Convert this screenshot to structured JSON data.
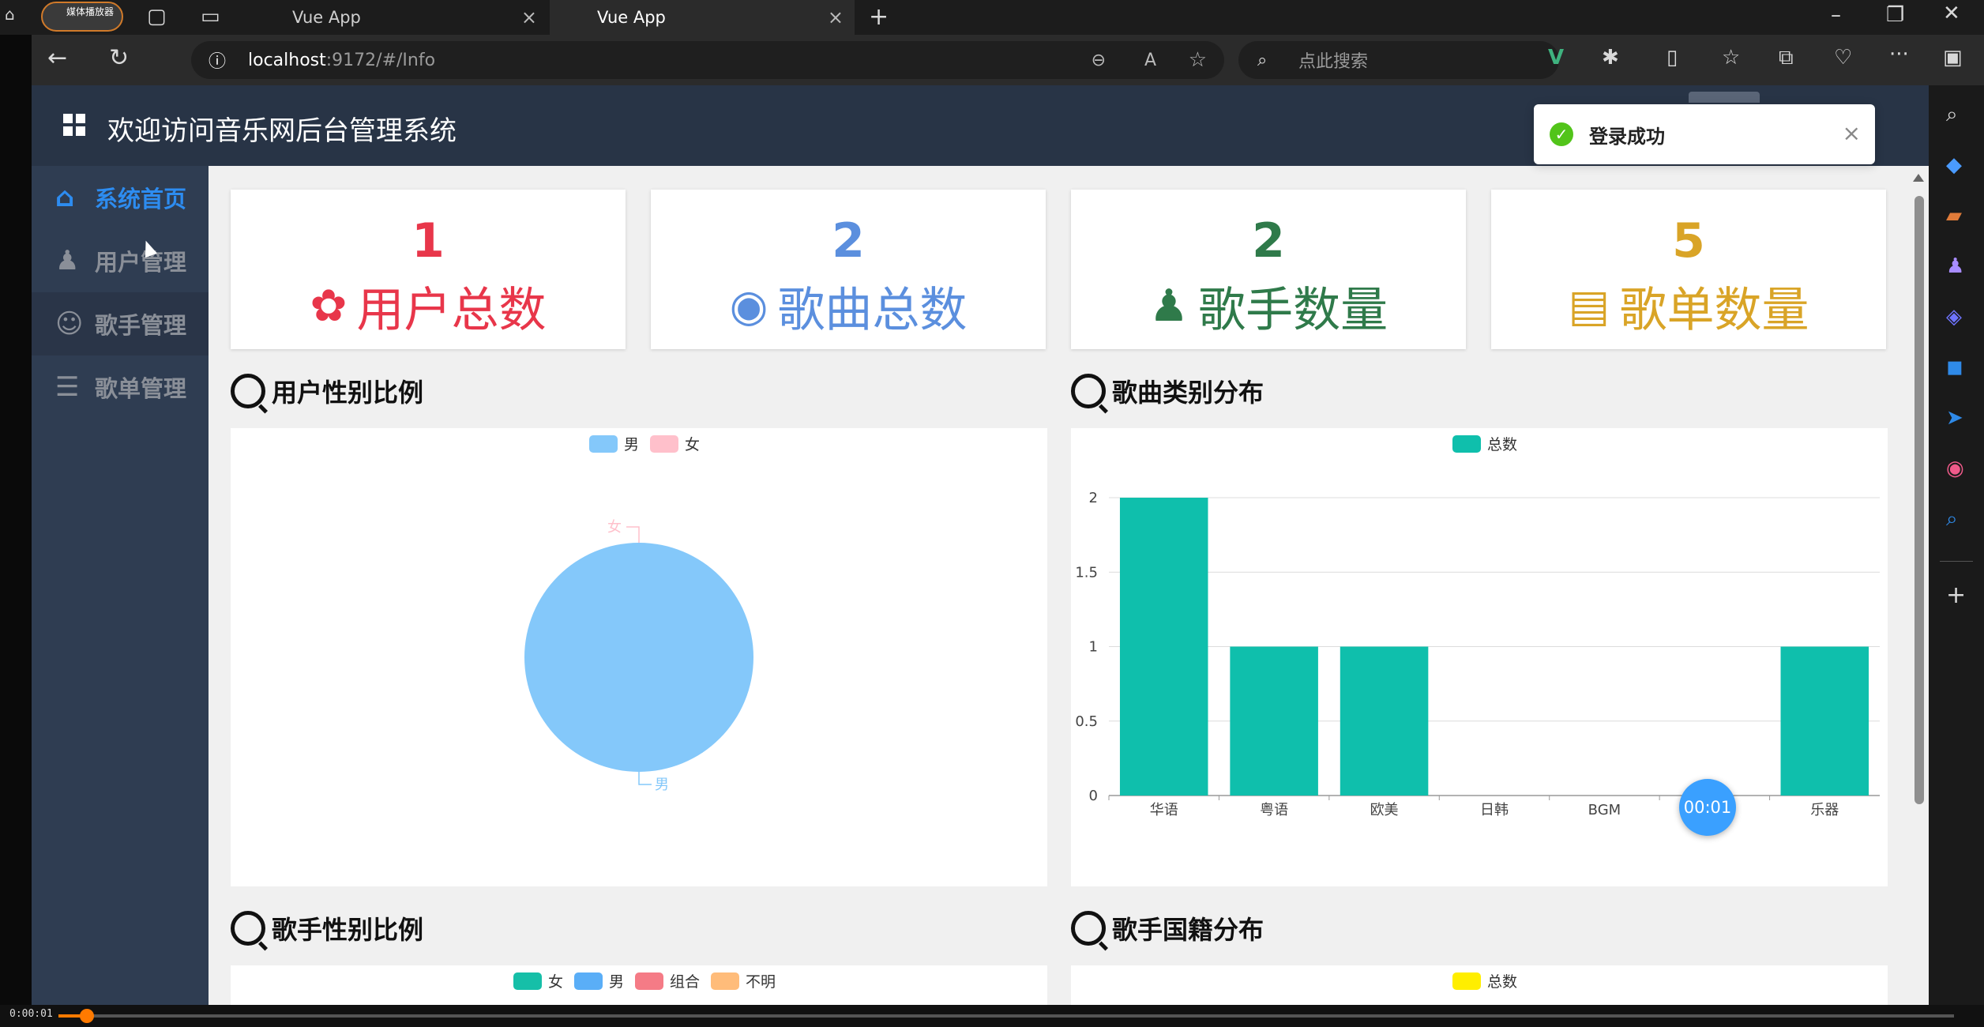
{
  "browser": {
    "media_badge": "媒体播放器",
    "tabs": [
      {
        "label": "Vue App",
        "active": false
      },
      {
        "label": "Vue App",
        "active": true
      }
    ],
    "url_host": "localhost",
    "url_rest": ":9172/#/Info",
    "search_placeholder": "点此搜索"
  },
  "app": {
    "title": "欢迎访问音乐网后台管理系统",
    "sidebar": {
      "items": [
        {
          "label": "系统首页",
          "icon": "home-icon"
        },
        {
          "label": "用户管理",
          "icon": "user-icon"
        },
        {
          "label": "歌手管理",
          "icon": "singer-icon"
        },
        {
          "label": "歌单管理",
          "icon": "list-icon"
        }
      ]
    },
    "cards": [
      {
        "value": "1",
        "label": "用户总数",
        "color": "#e8364a",
        "icon": "users-icon"
      },
      {
        "value": "2",
        "label": "歌曲总数",
        "color": "#5b8fde",
        "icon": "song-icon"
      },
      {
        "value": "2",
        "label": "歌手数量",
        "color": "#2f7a4a",
        "icon": "singer-icon"
      },
      {
        "value": "5",
        "label": "歌单数量",
        "color": "#d9a427",
        "icon": "playlist-icon"
      }
    ],
    "sections": {
      "user_gender": "用户性别比例",
      "song_category": "歌曲类别分布",
      "singer_gender": "歌手性别比例",
      "singer_nationality": "歌手国籍分布"
    },
    "toast": "登录成功"
  },
  "player": {
    "time": "0:00:01",
    "timer": "00:01",
    "progress": 0.015
  },
  "chart_data": [
    {
      "type": "pie",
      "title": "用户性别比例",
      "legend": [
        "男",
        "女"
      ],
      "colors": [
        "#84c8fa",
        "#ffc0cb"
      ],
      "values": [
        1,
        0
      ],
      "labels": [
        "男",
        "女"
      ]
    },
    {
      "type": "bar",
      "title": "歌曲类别分布",
      "legend": [
        "总数"
      ],
      "color": "#0fbfac",
      "categories": [
        "华语",
        "粤语",
        "欧美",
        "日韩",
        "BGM",
        "",
        "乐器"
      ],
      "values": [
        2,
        1,
        1,
        0,
        0,
        0,
        1
      ],
      "ylim": [
        0,
        2
      ],
      "yticks": [
        "0",
        "0.5",
        "1",
        "1.5",
        "2"
      ]
    },
    {
      "type": "pie",
      "title": "歌手性别比例",
      "legend": [
        "女",
        "男",
        "组合",
        "不明"
      ],
      "colors": [
        "#16bfa8",
        "#5aaef7",
        "#f57b86",
        "#ffbc7a"
      ]
    },
    {
      "type": "bar",
      "title": "歌手国籍分布",
      "legend": [
        "总数"
      ],
      "color": "#ffee00"
    }
  ]
}
